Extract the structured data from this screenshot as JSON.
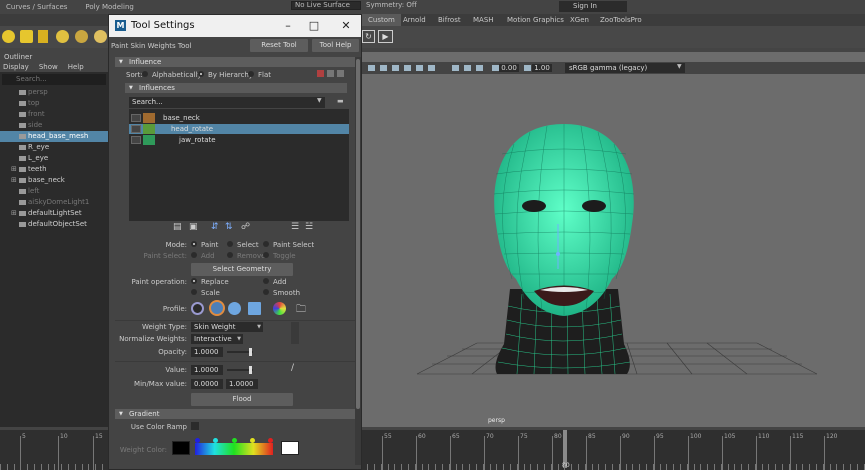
{
  "topbar": {
    "mode_menu": "Curves / Surfaces",
    "menu_poly": "Poly Modeling",
    "live_surface": "No Live Surface",
    "symmetry": "Symmetry: Off",
    "sign_in": "Sign In"
  },
  "shelf_tabs": [
    "Custom",
    "Arnold",
    "Bifrost",
    "MASH",
    "Motion Graphics",
    "XGen",
    "ZooToolsPro"
  ],
  "outliner": {
    "title": "Outliner",
    "menu": [
      "Display",
      "Show",
      "Help"
    ],
    "search_placeholder": "Search...",
    "items": [
      {
        "label": "persp",
        "dim": true
      },
      {
        "label": "top",
        "dim": true
      },
      {
        "label": "front",
        "dim": true
      },
      {
        "label": "side",
        "dim": true
      },
      {
        "label": "head_base_mesh",
        "selected": true
      },
      {
        "label": "R_eye"
      },
      {
        "label": "L_eye"
      },
      {
        "label": "teeth",
        "expandable": true
      },
      {
        "label": "base_neck",
        "expandable": true
      },
      {
        "label": "left",
        "dim": true
      },
      {
        "label": "aiSkyDomeLight1",
        "dim": true
      },
      {
        "label": "defaultLightSet",
        "expandable": true
      },
      {
        "label": "defaultObjectSet"
      }
    ]
  },
  "viewport": {
    "exposure": "0.00",
    "gamma": "1.00",
    "color_space": "sRGB gamma (legacy)",
    "camera": "persp"
  },
  "timeline": {
    "ticks": [
      "5",
      "10",
      "15",
      "55",
      "60",
      "65",
      "70",
      "75",
      "80",
      "85",
      "90",
      "95",
      "100",
      "105",
      "110",
      "115",
      "120"
    ],
    "current_frame": "80"
  },
  "tool_settings": {
    "window_title": "Tool Settings",
    "tool_name": "Paint Skin Weights Tool",
    "reset_tool": "Reset Tool",
    "tool_help": "Tool Help",
    "influence_header": "Influence",
    "sort_label": "Sort:",
    "sort_options": [
      "Alphabetically",
      "By Hierarchy",
      "Flat"
    ],
    "influences_header": "Influences",
    "search_placeholder": "Search...",
    "influences": [
      {
        "name": "base_neck",
        "color": "#a06a2f",
        "selected": false
      },
      {
        "name": "head_rotate",
        "color": "#5a9b3a",
        "selected": true
      },
      {
        "name": "jaw_rotate",
        "color": "#2f9a5a",
        "selected": false
      }
    ],
    "mode_label": "Mode:",
    "mode_options": [
      "Paint",
      "Select",
      "Paint Select"
    ],
    "paint_select_label": "Paint Select:",
    "paint_select_options": [
      "Add",
      "Remove",
      "Toggle"
    ],
    "select_geometry": "Select Geometry",
    "paint_operation_label": "Paint operation:",
    "paint_operations": [
      "Replace",
      "Add",
      "Scale",
      "Smooth"
    ],
    "profile_label": "Profile:",
    "weight_type_label": "Weight Type:",
    "weight_type": "Skin Weight",
    "normalize_label": "Normalize Weights:",
    "normalize_value": "Interactive",
    "opacity_label": "Opacity:",
    "opacity_value": "1.0000",
    "value_label": "Value:",
    "value_value": "1.0000",
    "minmax_label": "Min/Max value:",
    "min_value": "0.0000",
    "max_value": "1.0000",
    "flood": "Flood",
    "gradient_header": "Gradient",
    "use_color_ramp": "Use Color Ramp",
    "weight_color_label": "Weight Color:"
  },
  "colors": {
    "selection": "#5285a6",
    "wireframe": "#3dffb0",
    "viewport_bg": "#6c6c6c",
    "panel_bg": "#444444"
  }
}
